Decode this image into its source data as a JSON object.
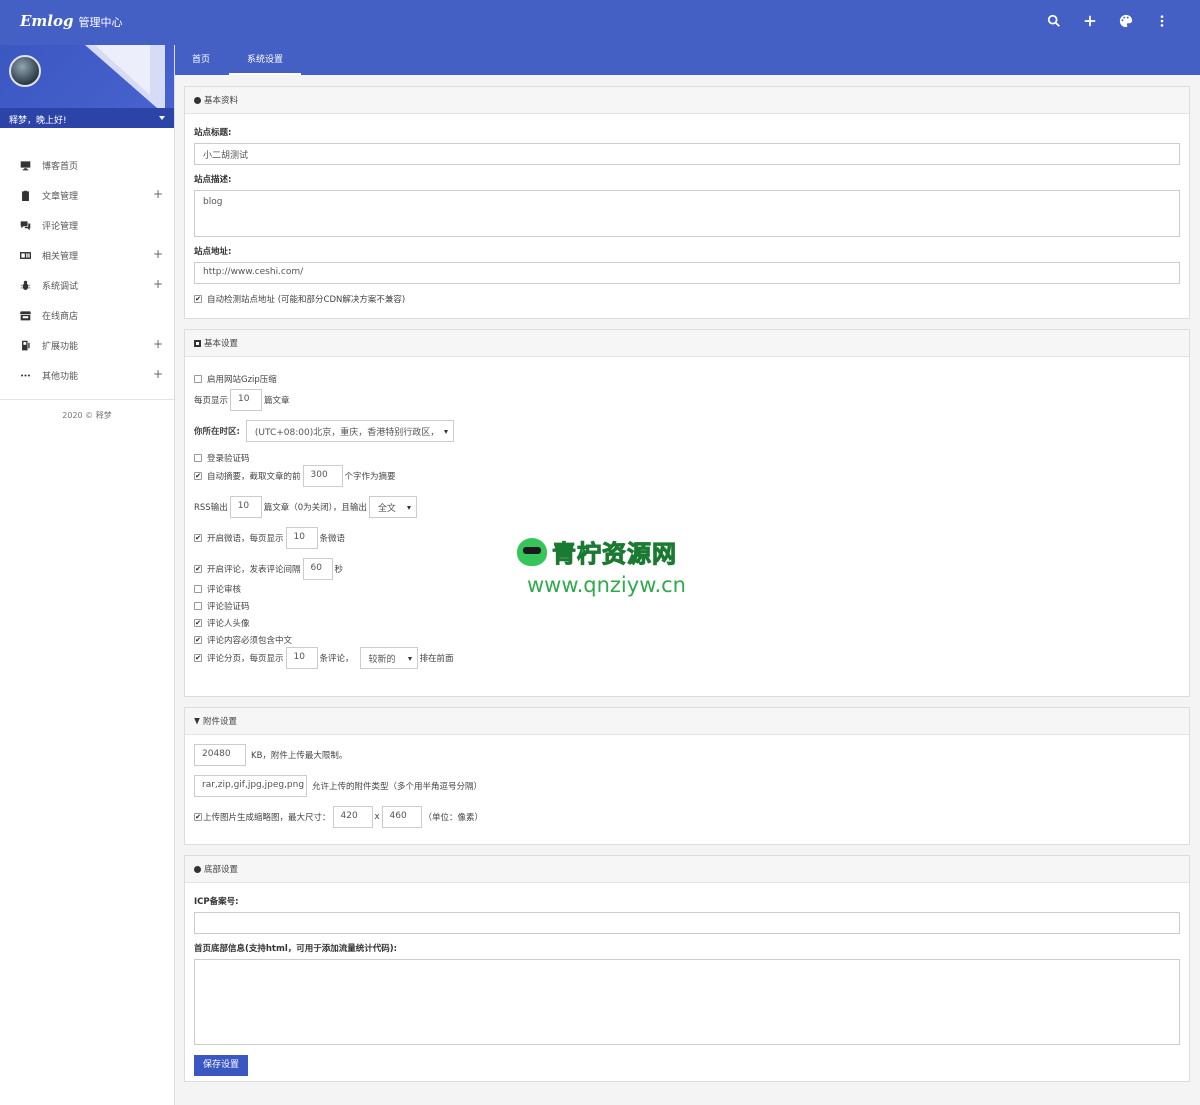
{
  "header": {
    "logo": "Emlog",
    "title": "管理中心",
    "icons": [
      "search-icon",
      "plus-icon",
      "palette-icon",
      "more-vertical-icon"
    ]
  },
  "sidebar": {
    "greeting": "释梦，晚上好!",
    "items": [
      {
        "label": "博客首页",
        "icon": "monitor-icon",
        "expandable": false
      },
      {
        "label": "文章管理",
        "icon": "clipboard-icon",
        "expandable": true
      },
      {
        "label": "评论管理",
        "icon": "comments-icon",
        "expandable": false
      },
      {
        "label": "相关管理",
        "icon": "id-card-icon",
        "expandable": true
      },
      {
        "label": "系统调试",
        "icon": "bug-icon",
        "expandable": true
      },
      {
        "label": "在线商店",
        "icon": "store-icon",
        "expandable": false
      },
      {
        "label": "扩展功能",
        "icon": "plug-icon",
        "expandable": true
      },
      {
        "label": "其他功能",
        "icon": "dots-icon",
        "expandable": true
      }
    ],
    "plus": "+",
    "footer": "2020 © 释梦"
  },
  "tabs": [
    {
      "label": "首页",
      "active": false
    },
    {
      "label": "系统设置",
      "active": true
    }
  ],
  "basic_info": {
    "title": "基本资料",
    "site_title_label": "站点标题:",
    "site_title_value": "小二胡测试",
    "site_desc_label": "站点描述:",
    "site_desc_value": "blog",
    "site_url_label": "站点地址:",
    "site_url_value": "http://www.ceshi.com/",
    "auto_detect_label": "自动检测站点地址 (可能和部分CDN解决方案不兼容)",
    "auto_detect_checked": true
  },
  "basic_settings": {
    "title": "基本设置",
    "gzip_label": "启用网站Gzip压缩",
    "per_page_prefix": "每页显示",
    "per_page_value": "10",
    "per_page_suffix": "篇文章",
    "timezone_label": "你所在时区:",
    "timezone_value": "(UTC+08:00)北京，重庆，香港特别行政区，",
    "login_captcha_label": "登录验证码",
    "auto_excerpt_prefix": "自动摘要，截取文章的前",
    "auto_excerpt_value": "300",
    "auto_excerpt_suffix": "个字作为摘要",
    "rss_prefix": "RSS输出",
    "rss_value": "10",
    "rss_middle": "篇文章（0为关闭），且输出",
    "rss_mode": "全文",
    "twitter_prefix": "开启微语，每页显示",
    "twitter_value": "10",
    "twitter_suffix": "条微语",
    "comment_prefix": "开启评论，发表评论间隔",
    "comment_value": "60",
    "comment_suffix": "秒",
    "comment_review": "评论审核",
    "comment_captcha": "评论验证码",
    "comment_avatar": "评论人头像",
    "comment_chinese": "评论内容必须包含中文",
    "comment_page_prefix": "评论分页，每页显示",
    "comment_page_value": "10",
    "comment_page_middle": "条评论，",
    "comment_order": "较新的",
    "comment_page_suffix": "排在前面"
  },
  "attachment": {
    "title": "附件设置",
    "max_size_value": "20480",
    "max_size_label": "KB，附件上传最大限制。",
    "types_value": "rar,zip,gif,jpg,jpeg,png",
    "types_label": "允许上传的附件类型（多个用半角逗号分隔）",
    "thumb_label": "上传图片生成缩略图，最大尺寸：",
    "thumb_w": "420",
    "thumb_x": "x",
    "thumb_h": "460",
    "thumb_unit": "（单位：像素）"
  },
  "footer_settings": {
    "title": "底部设置",
    "icp_label": "ICP备案号:",
    "icp_value": "",
    "footer_info_label": "首页底部信息(支持html，可用于添加流量统计代码):",
    "footer_info_value": "",
    "save_label": "保存设置"
  },
  "watermark": {
    "title": "青柠资源网",
    "url": "www.qnziyw.cn"
  }
}
